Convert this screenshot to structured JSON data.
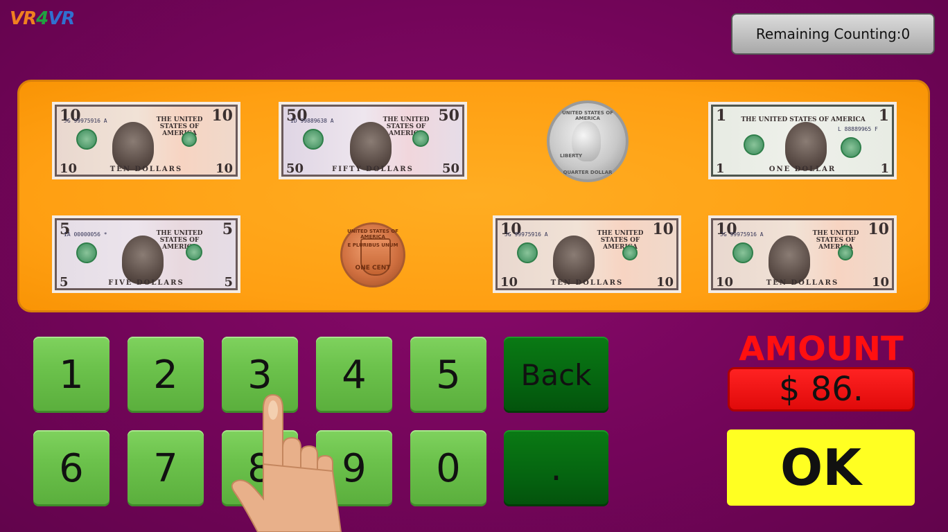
{
  "logo": {
    "part1": "VR",
    "part2": "4",
    "part3": "VR"
  },
  "remaining": {
    "label": "Remaining Counting:0"
  },
  "tray": {
    "bills": [
      {
        "denomination": "10",
        "word": "TEN DOLLARS",
        "title": "THE UNITED STATES OF AMERICA",
        "serial": "JG 99975916 A"
      },
      {
        "denomination": "50",
        "word": "FIFTY DOLLARS",
        "title": "THE UNITED STATES OF AMERICA",
        "serial": "ID 99889638 A"
      },
      {
        "denomination": "1",
        "word": "ONE DOLLAR",
        "title": "THE UNITED STATES OF AMERICA",
        "serial": "L 88889965 F"
      },
      {
        "denomination": "5",
        "word": "FIVE DOLLARS",
        "title": "THE UNITED STATES OF AMERICA",
        "serial": "IA 00000056 *"
      },
      {
        "denomination": "10",
        "word": "TEN DOLLARS",
        "title": "THE UNITED STATES OF AMERICA",
        "serial": "JG 99975916 A"
      },
      {
        "denomination": "10",
        "word": "TEN DOLLARS",
        "title": "THE UNITED STATES OF AMERICA",
        "serial": "JG 99975916 A"
      }
    ],
    "coins": {
      "quarter": {
        "top": "UNITED STATES OF AMERICA",
        "bottom": "QUARTER DOLLAR",
        "left": "LIBERTY"
      },
      "penny": {
        "top": "UNITED STATES OF AMERICA",
        "bottom": "ONE CENT",
        "motto": "E PLURIBUS UNUM"
      }
    }
  },
  "keypad": {
    "row1": [
      "1",
      "2",
      "3",
      "4",
      "5"
    ],
    "row2": [
      "6",
      "7",
      "8",
      "9",
      "0"
    ],
    "back": "Back",
    "dot": "."
  },
  "amount": {
    "label": "AMOUNT",
    "value": "$ 86."
  },
  "ok": {
    "label": "OK"
  },
  "colors": {
    "background": "#74055a",
    "tray": "#ffa01a",
    "key": "#6cc24c",
    "amount": "#ff1a1a",
    "ok": "#ffff22"
  }
}
